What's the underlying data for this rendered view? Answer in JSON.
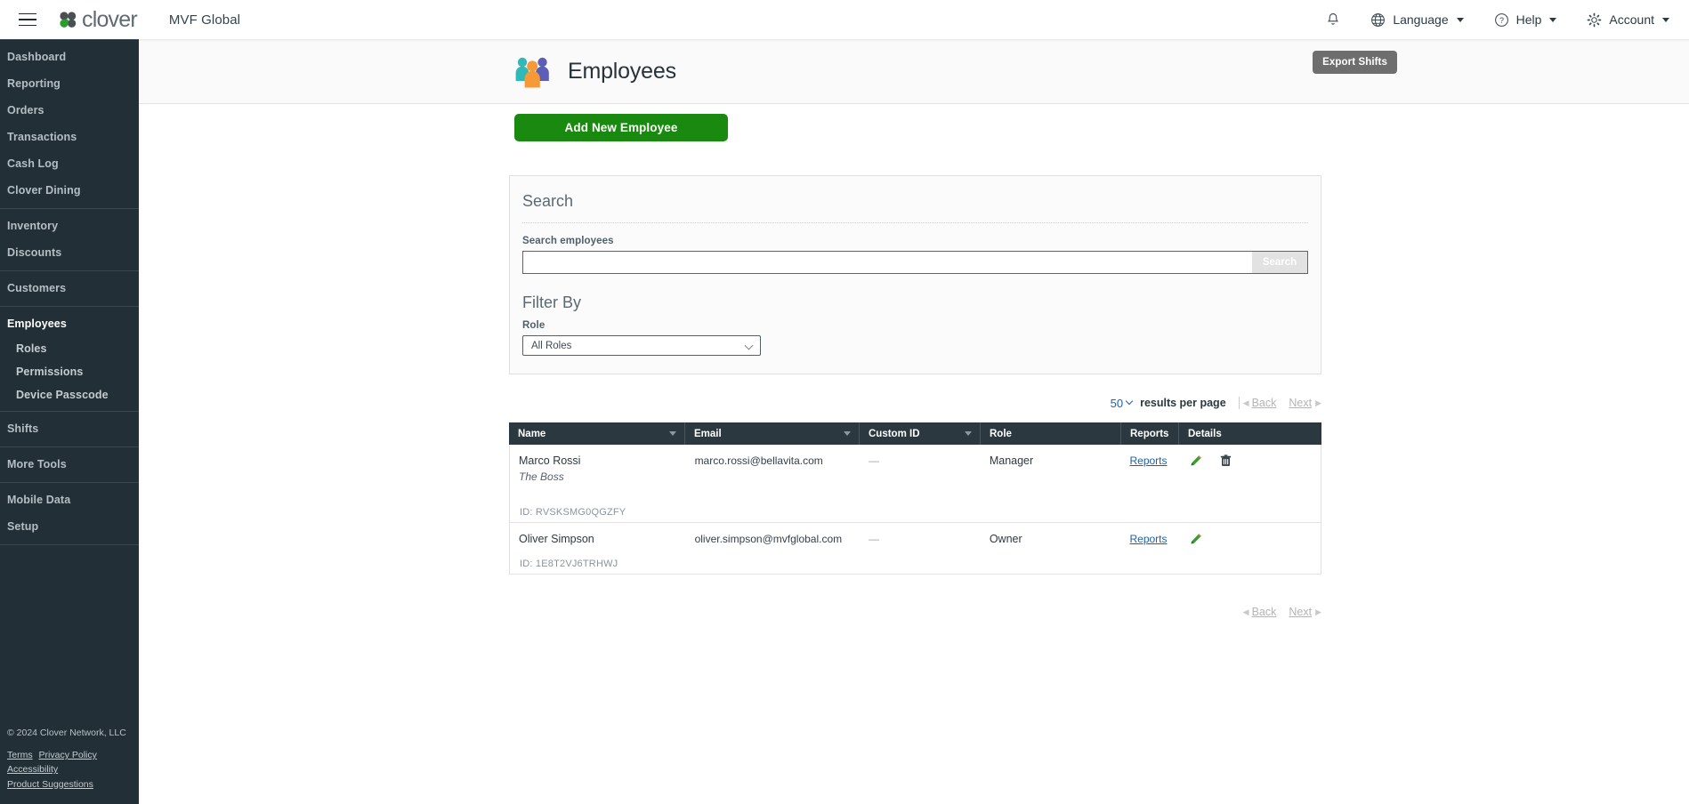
{
  "topbar": {
    "menu_icon": "hamburger-icon",
    "brand": "clover",
    "merchant": "MVF Global",
    "notifications_icon": "bell-icon",
    "language_icon": "globe-icon",
    "language_label": "Language",
    "help_icon": "question-circle-icon",
    "help_label": "Help",
    "account_icon": "gear-icon",
    "account_label": "Account"
  },
  "sidebar": {
    "groups": [
      {
        "items": [
          {
            "label": "Dashboard",
            "active": false,
            "sub": false
          },
          {
            "label": "Reporting",
            "active": false,
            "sub": false
          },
          {
            "label": "Orders",
            "active": false,
            "sub": false
          },
          {
            "label": "Transactions",
            "active": false,
            "sub": false
          },
          {
            "label": "Cash Log",
            "active": false,
            "sub": false
          },
          {
            "label": "Clover Dining",
            "active": false,
            "sub": false
          }
        ]
      },
      {
        "items": [
          {
            "label": "Inventory",
            "active": false,
            "sub": false
          },
          {
            "label": "Discounts",
            "active": false,
            "sub": false
          }
        ]
      },
      {
        "items": [
          {
            "label": "Customers",
            "active": false,
            "sub": false
          }
        ]
      },
      {
        "items": [
          {
            "label": "Employees",
            "active": true,
            "sub": false
          },
          {
            "label": "Roles",
            "active": false,
            "sub": true
          },
          {
            "label": "Permissions",
            "active": false,
            "sub": true
          },
          {
            "label": "Device Passcode",
            "active": false,
            "sub": true
          }
        ]
      },
      {
        "items": [
          {
            "label": "Shifts",
            "active": false,
            "sub": false
          }
        ]
      },
      {
        "items": [
          {
            "label": "More Tools",
            "active": false,
            "sub": false
          }
        ]
      },
      {
        "items": [
          {
            "label": "Mobile Data",
            "active": false,
            "sub": false
          },
          {
            "label": "Setup",
            "active": false,
            "sub": false
          }
        ]
      }
    ]
  },
  "footer": {
    "copyright": "© 2024 Clover Network, LLC",
    "terms": "Terms",
    "privacy": "Privacy Policy",
    "accessibility": "Accessibility",
    "suggestions": "Product Suggestions"
  },
  "page": {
    "title": "Employees",
    "title_icon": "people-group-icon",
    "export_button": "Export Shifts",
    "add_button": "Add New Employee"
  },
  "search_panel": {
    "heading": "Search",
    "field_label": "Search employees",
    "input_value": "",
    "input_placeholder": "",
    "search_button": "Search",
    "filter_heading": "Filter By",
    "role_label": "Role",
    "role_selected": "All Roles"
  },
  "pagination": {
    "per_page_value": "50",
    "per_page_label": "results per page",
    "back": "Back",
    "next": "Next"
  },
  "table": {
    "columns": [
      {
        "label": "Name",
        "sortable": true
      },
      {
        "label": "Email",
        "sortable": true
      },
      {
        "label": "Custom ID",
        "sortable": true
      },
      {
        "label": "Role",
        "sortable": false
      },
      {
        "label": "Reports",
        "sortable": false
      },
      {
        "label": "Details",
        "sortable": false
      }
    ],
    "rows": [
      {
        "name": "Marco Rossi",
        "nickname": "The Boss",
        "id_line": "ID: RVSKSMG0QGZFY",
        "email": "marco.rossi@bellavita.com",
        "custom_id": "—",
        "role": "Manager",
        "reports": "Reports",
        "has_edit": true,
        "has_delete": true
      },
      {
        "name": "Oliver Simpson",
        "nickname": "",
        "id_line": "ID: 1E8T2VJ6TRHWJ",
        "email": "oliver.simpson@mvfglobal.com",
        "custom_id": "—",
        "role": "Owner",
        "reports": "Reports",
        "has_edit": true,
        "has_delete": false
      }
    ],
    "edit_icon": "pencil-icon",
    "delete_icon": "trash-icon"
  },
  "colors": {
    "sidebar_bg": "#232f36",
    "accent_green": "#198a0f",
    "link_blue": "#1f5fa8",
    "table_header": "#2c3840",
    "export_gray": "#6e6e6e"
  }
}
